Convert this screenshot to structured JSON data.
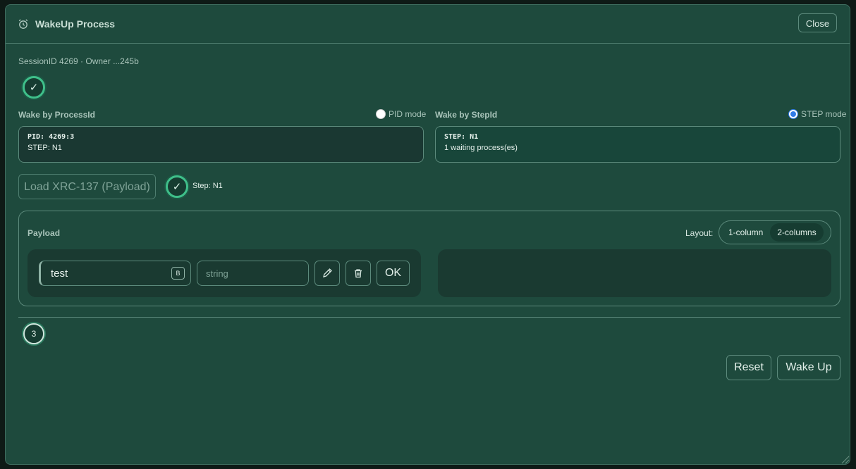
{
  "modal": {
    "title": "WakeUp Process",
    "title_icon": "alarm-clock-icon",
    "close_label": "Close"
  },
  "session": {
    "text": "SessionID 4269 · Owner ...245b"
  },
  "steps": {
    "first_check": "✓",
    "step_check": "✓",
    "third_number": "3"
  },
  "wake_by_process": {
    "label": "Wake by ProcessId",
    "mode_label": "PID mode",
    "selected": false,
    "line1": "PID: 4269:3",
    "line2": "STEP: N1"
  },
  "wake_by_step": {
    "label": "Wake by StepId",
    "mode_label": "STEP mode",
    "selected": true,
    "line1": "STEP: N1",
    "line2": "1 waiting process(es)"
  },
  "load_button": {
    "label": "Load XRC-137 (Payload)"
  },
  "step_indicator": {
    "text": "Step: N1"
  },
  "payload": {
    "label": "Payload",
    "layout_label": "Layout:",
    "layout_options": [
      "1-column",
      "2-columns"
    ],
    "layout_selected": "2-columns",
    "row": {
      "key_value": "test",
      "badge": "B",
      "type_placeholder": "string",
      "edit_icon": "pencil-icon",
      "delete_icon": "trash-icon",
      "ok_label": "OK"
    }
  },
  "footer": {
    "reset_label": "Reset",
    "wake_label": "Wake Up"
  },
  "colors": {
    "modal_bg": "#1e4a3d",
    "border": "#5c8a7c",
    "accent_green": "#3fbf8a",
    "radio_blue": "#2f7be8"
  }
}
